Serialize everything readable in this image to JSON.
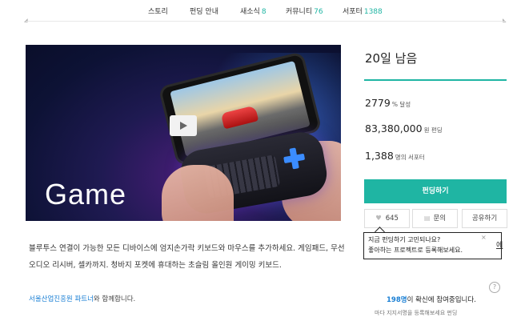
{
  "nav": {
    "items": [
      {
        "label": "스토리",
        "count": ""
      },
      {
        "label": "펀딩 안내",
        "count": ""
      },
      {
        "label": "새소식",
        "count": "8"
      },
      {
        "label": "커뮤니티",
        "count": "76"
      },
      {
        "label": "서포터",
        "count": "1388"
      }
    ]
  },
  "hero": {
    "caption": "Game",
    "play_icon": "play-icon"
  },
  "description": "블루투스 연결이 가능한 모든 디바이스에 엄지손가락 키보드와 마우스를 추가하세요. 게임패드, 무선 오디오 리시버, 셀카까지. 청바지 포켓에 휴대하는 초슬림 올인원 게이밍 키보드.",
  "partner": {
    "link": "서울산업진흥원 파트너",
    "suffix": "와 함께합니다."
  },
  "funding": {
    "days_left": "20일 남음",
    "percent": "2779",
    "percent_unit": "% 달성",
    "amount": "83,380,000",
    "amount_unit": "원 펀딩",
    "supporters": "1,388",
    "supporters_unit": "명의 서포터",
    "fund_button": "펀딩하기",
    "like_count": "645",
    "inquiry_label": "문의",
    "share_label": "공유하기"
  },
  "tooltip": {
    "line1": "지금 펀딩하기 고민되나요?",
    "line2": "좋아하는 프로젝트로 등록해보세요.",
    "close": "×",
    "side_link": "에"
  },
  "social_proof": {
    "count": "198명",
    "text": "이 확신에 참여중입니다.",
    "sub": "마다 지지서명을 등록해보세요 펀딩"
  },
  "colors": {
    "accent": "#1fb5a3",
    "link": "#1a7fd4"
  }
}
